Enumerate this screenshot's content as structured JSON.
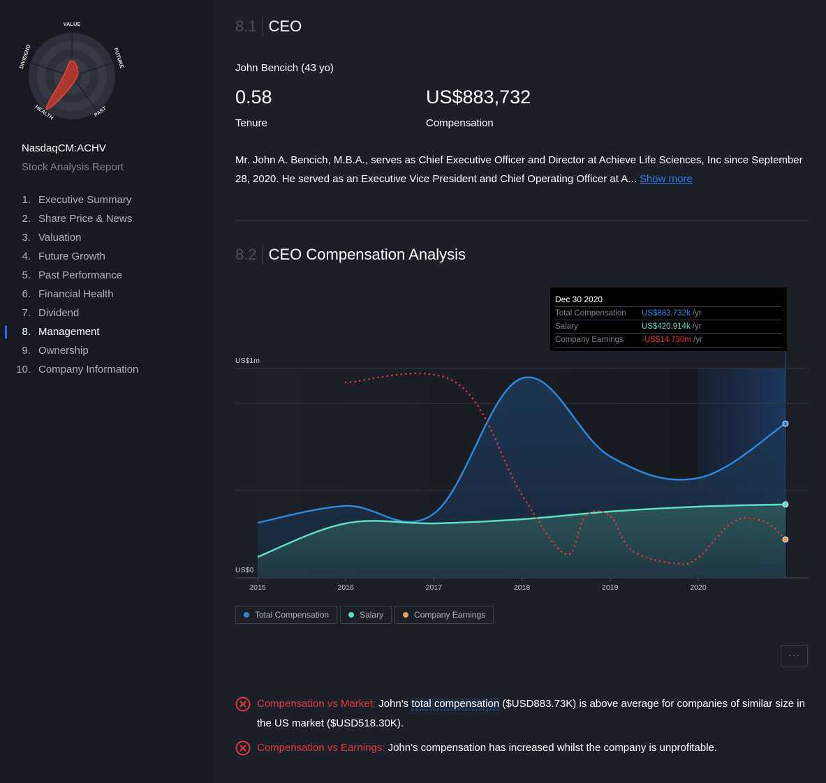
{
  "sidebar": {
    "snowflake": {
      "axes": [
        "VALUE",
        "FUTURE",
        "PAST",
        "HEALTH",
        "DIVIDEND"
      ],
      "scores": {
        "VALUE": 1,
        "FUTURE": 1,
        "PAST": 0,
        "HEALTH": 5,
        "DIVIDEND": 0
      },
      "shape_color": "#e2383f"
    },
    "ticker": "NasdaqCM:ACHV",
    "subtitle": "Stock Analysis Report",
    "nav": [
      {
        "num": "1.",
        "label": "Executive Summary",
        "active": false
      },
      {
        "num": "2.",
        "label": "Share Price & News",
        "active": false
      },
      {
        "num": "3.",
        "label": "Valuation",
        "active": false
      },
      {
        "num": "4.",
        "label": "Future Growth",
        "active": false
      },
      {
        "num": "5.",
        "label": "Past Performance",
        "active": false
      },
      {
        "num": "6.",
        "label": "Financial Health",
        "active": false
      },
      {
        "num": "7.",
        "label": "Dividend",
        "active": false
      },
      {
        "num": "8.",
        "label": "Management",
        "active": true
      },
      {
        "num": "9.",
        "label": "Ownership",
        "active": false
      },
      {
        "num": "10.",
        "label": "Company Information",
        "active": false
      }
    ]
  },
  "ceo_section": {
    "number": "8.1",
    "title": "CEO",
    "name": "John Bencich (43 yo)",
    "tenure_value": "0.58",
    "tenure_label": "Tenure",
    "compensation_value": "US$883,732",
    "compensation_label": "Compensation",
    "bio": "Mr. John A. Bencich, M.B.A., serves as Chief Executive Officer and Director at Achieve Life Sciences, Inc since September 28, 2020. He served as an Executive Vice President and Chief Operating Officer at A...",
    "show_more": "Show more"
  },
  "comp_section": {
    "number": "8.2",
    "title": "CEO Compensation Analysis",
    "more_button": "···"
  },
  "tooltip": {
    "date": "Dec 30 2020",
    "rows": [
      {
        "label": "Total Compensation",
        "value": "US$883.732k",
        "unit": "/yr",
        "color": "#2f86d9"
      },
      {
        "label": "Salary",
        "value": "US$420.914k",
        "unit": "/yr",
        "color": "#5fdcc4"
      },
      {
        "label": "Company Earnings",
        "value": "-US$14.730m",
        "unit": "/yr",
        "color": "#e2383f"
      }
    ]
  },
  "chart_data": {
    "type": "area",
    "title": "CEO Compensation Analysis",
    "xlabel": "",
    "ylabel": "",
    "y_tick_labels": [
      "US$0",
      "US$1m"
    ],
    "x_tick_labels": [
      "2015",
      "2016",
      "2017",
      "2018",
      "2019",
      "2020"
    ],
    "xlim": [
      2015,
      2021.25
    ],
    "ylim_usd_k": [
      0,
      1200
    ],
    "grid": true,
    "legend_position": "bottom-left",
    "series": [
      {
        "name": "Total Compensation",
        "color": "#2f86d9",
        "unit": "US$k",
        "x": [
          2015,
          2016,
          2017,
          2018,
          2019,
          2020,
          2020.99
        ],
        "values": [
          316,
          412,
          368,
          1144,
          696,
          572,
          883.732
        ]
      },
      {
        "name": "Salary",
        "color": "#5fdcc4",
        "unit": "US$k",
        "x": [
          2015,
          2016,
          2017,
          2018,
          2019,
          2020,
          2020.99
        ],
        "values": [
          120,
          312,
          312,
          336,
          380,
          408,
          420.914
        ]
      },
      {
        "name": "Company Earnings",
        "color": "#e2383f",
        "marker_color": "#e0a060",
        "style": "dotted",
        "unit": "US$m",
        "x": [
          2016,
          2017.25,
          2018,
          2018.5,
          2018.72,
          2019,
          2019.25,
          2019.75,
          2020,
          2020.4,
          2020.75,
          2020.99
        ],
        "values": [
          -1.2,
          -1.2,
          -10.9,
          -16.0,
          -12.7,
          -12.7,
          -15.7,
          -16.8,
          -16.3,
          -13.2,
          -13.2,
          -14.73
        ]
      }
    ],
    "highlight_range": [
      2020,
      2020.99
    ]
  },
  "legend": [
    {
      "label": "Total Compensation",
      "color": "#2f86d9"
    },
    {
      "label": "Salary",
      "color": "#5fdcc4"
    },
    {
      "label": "Company Earnings",
      "color": "#e0a060"
    }
  ],
  "risks": [
    {
      "label": "Compensation vs Market:",
      "pre": " John's ",
      "highlight": "total compensation",
      "post": " ($USD883.73K) is above average for companies of similar size in the US market ($USD518.30K)."
    },
    {
      "label": "Compensation vs Earnings:",
      "pre": " John's compensation has increased whilst the company is unprofitable.",
      "highlight": "",
      "post": ""
    }
  ]
}
